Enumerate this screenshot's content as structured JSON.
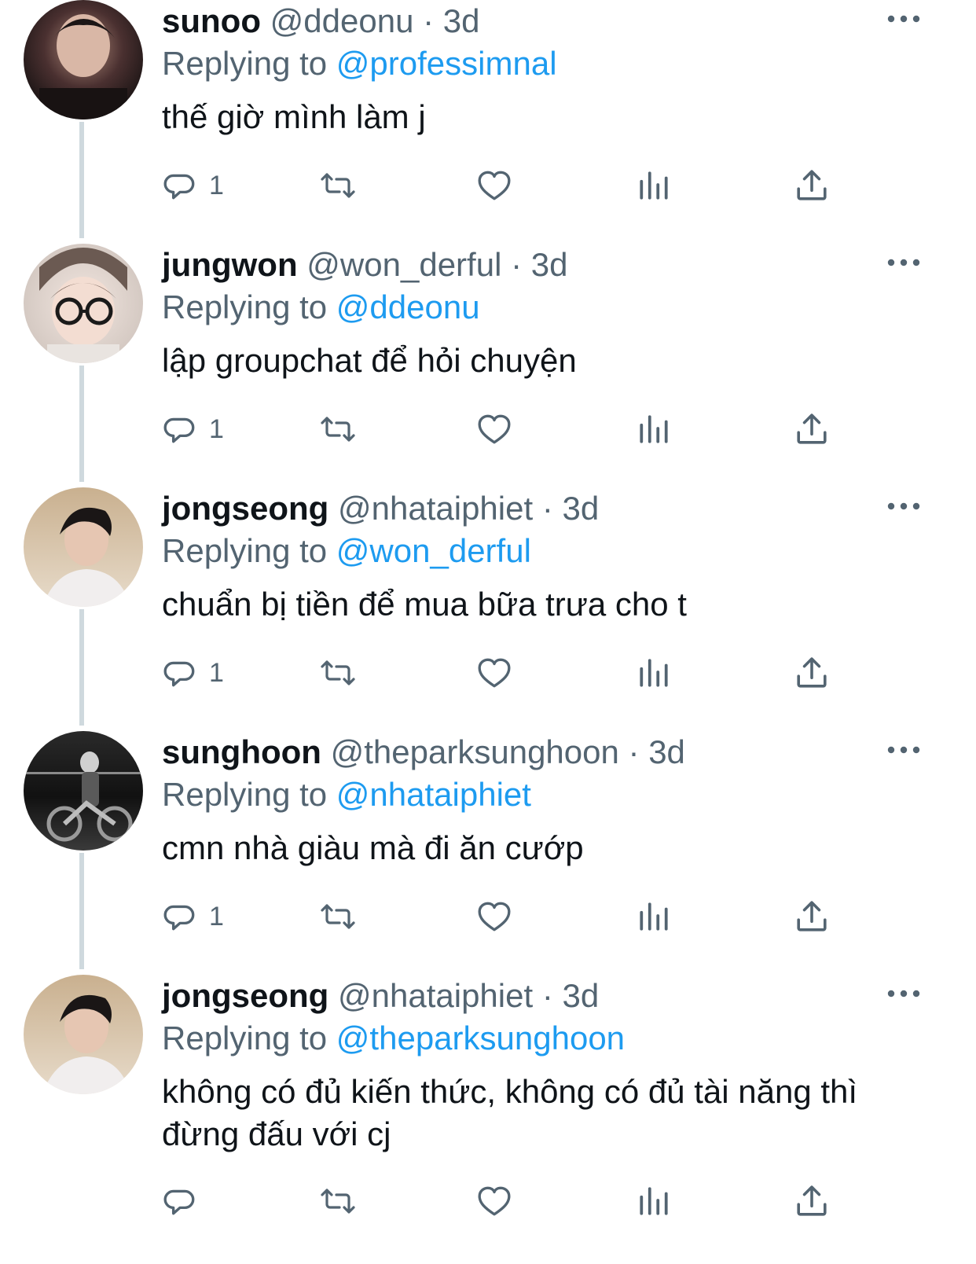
{
  "tweets": [
    {
      "name": "sunoo",
      "handle": "@ddeonu",
      "separator": "·",
      "time": "3d",
      "replying_label": "Replying to",
      "replying_to": "@professimnal",
      "text": "thế giờ mình làm j",
      "reply_count": "1",
      "avatar_icon": "avatar-photo-dark-portrait"
    },
    {
      "name": "jungwon",
      "handle": "@won_derful",
      "separator": "·",
      "time": "3d",
      "replying_label": "Replying to",
      "replying_to": "@ddeonu",
      "text": "lập groupchat để hỏi chuyện",
      "reply_count": "1",
      "avatar_icon": "avatar-photo-glasses"
    },
    {
      "name": "jongseong",
      "handle": "@nhataiphiet",
      "separator": "·",
      "time": "3d",
      "replying_label": "Replying to",
      "replying_to": "@won_derful",
      "text": "chuẩn bị tiền để mua bữa trưa cho t",
      "reply_count": "1",
      "avatar_icon": "avatar-photo-beach"
    },
    {
      "name": "sunghoon",
      "handle": "@theparksunghoon",
      "separator": "·",
      "time": "3d",
      "replying_label": "Replying to",
      "replying_to": "@nhataiphiet",
      "text": "cmn nhà giàu mà đi ăn cướp",
      "reply_count": "1",
      "avatar_icon": "avatar-photo-motorcycle-bw"
    },
    {
      "name": "jongseong",
      "handle": "@nhataiphiet",
      "separator": "·",
      "time": "3d",
      "replying_label": "Replying to",
      "replying_to": "@theparksunghoon",
      "text": "không có đủ kiến thức, không có đủ tài năng thì đừng đấu với cj",
      "reply_count": "",
      "avatar_icon": "avatar-photo-beach"
    }
  ],
  "colors": {
    "text_primary": "#0f1419",
    "text_secondary": "#536471",
    "link": "#1d9bf0",
    "thread_line": "#cfd9de"
  },
  "icons": [
    "reply-icon",
    "retweet-icon",
    "like-icon",
    "views-icon",
    "share-icon",
    "more-icon"
  ]
}
